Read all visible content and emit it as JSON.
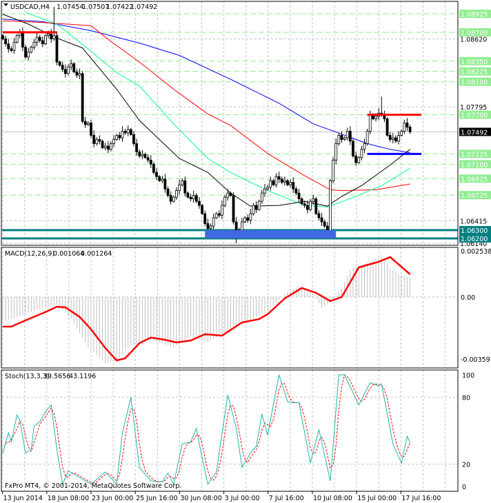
{
  "header": {
    "symbol": "USDCAD,H4",
    "open": "1.07454",
    "high": "1.07507",
    "low": "1.07422",
    "close": "1.07492"
  },
  "macd_header": {
    "name": "MACD(12,26,9)",
    "main": "0.001064",
    "signal": "0.001264"
  },
  "stoch_header": {
    "name": "Stoch(13,3,3)",
    "main": "39.5656",
    "signal": "43.1196"
  },
  "copyright": "FxPro MT4, © 2001-2014, MetaQuotes Software Corp.",
  "colors": {
    "level": "#90EE90",
    "support": "#008080",
    "candle": "#000000",
    "ma_blue": "#0000FF",
    "ma_red": "#FF0000",
    "ma_green": "#00FA9A",
    "ma_black": "#000000",
    "macd_signal": "#FF0000",
    "stoch_main": "#20B2AA",
    "stoch_signal": "#FF0000",
    "zone": "#4169E1"
  },
  "chart_data": [
    {
      "type": "candlestick",
      "title": "USDCAD,H4",
      "ylim": [
        1.0612,
        1.0895
      ],
      "price_labels": [
        "1.08620",
        "1.07795",
        "1.06415",
        "1.06140"
      ],
      "level_labels": [
        "1.08925",
        "1.08700",
        "1.08350",
        "1.08225",
        "1.08100",
        "1.07700",
        "1.07225",
        "1.07100",
        "1.06925",
        "1.06725"
      ],
      "support_labels": [
        "1.06300",
        "1.06200"
      ],
      "current_price": "1.07492",
      "x_labels": [
        "13 Jun 2014",
        "18 Jun 08:00",
        "23 Jun 00:00",
        "25 Jun 16:00",
        "30 Jun 08:00",
        "3 Jul 00:00",
        "7 Jul 16:00",
        "10 Jul 08:00",
        "15 Jul 00:00",
        "17 Jul 16:00"
      ],
      "closes": [
        1.0862,
        1.0856,
        1.085,
        1.0848,
        1.0858,
        1.0866,
        1.087,
        1.0852,
        1.084,
        1.0846,
        1.0852,
        1.0858,
        1.0864,
        1.086,
        1.0856,
        1.0866,
        1.0868,
        1.0862,
        1.0866,
        1.0834,
        1.083,
        1.0825,
        1.082,
        1.0828,
        1.0832,
        1.0822,
        1.0818,
        1.082,
        1.0762,
        1.0758,
        1.076,
        1.0745,
        1.0735,
        1.074,
        1.0738,
        1.073,
        1.0732,
        1.0728,
        1.0735,
        1.074,
        1.0745,
        1.0742,
        1.075,
        1.0748,
        1.0752,
        1.0746,
        1.0735,
        1.0725,
        1.072,
        1.0722,
        1.0718,
        1.0715,
        1.071,
        1.07,
        1.0695,
        1.069,
        1.0692,
        1.068,
        1.0672,
        1.0665,
        1.067,
        1.0678,
        1.0685,
        1.069,
        1.0675,
        1.067,
        1.0668,
        1.0672,
        1.0665,
        1.066,
        1.065,
        1.0638,
        1.0632,
        1.0635,
        1.0645,
        1.065,
        1.0648,
        1.066,
        1.067,
        1.0675,
        1.0672,
        1.064,
        1.0625,
        1.063,
        1.064,
        1.0645,
        1.0642,
        1.065,
        1.066,
        1.0655,
        1.0665,
        1.0675,
        1.068,
        1.0682,
        1.069,
        1.0685,
        1.0695,
        1.0692,
        1.0688,
        1.069,
        1.0685,
        1.0688,
        1.068,
        1.0675,
        1.0668,
        1.0662,
        1.066,
        1.0655,
        1.0665,
        1.0668,
        1.065,
        1.0645,
        1.064,
        1.0635,
        1.0628,
        1.069,
        1.0715,
        1.0735,
        1.0745,
        1.074,
        1.0742,
        1.075,
        1.0738,
        1.072,
        1.0712,
        1.0718,
        1.0728,
        1.0735,
        1.075,
        1.077,
        1.0765,
        1.0768,
        1.0772,
        1.077,
        1.0765,
        1.0745,
        1.074,
        1.0742,
        1.0738,
        1.0745,
        1.075,
        1.076,
        1.0755,
        1.07492
      ],
      "extreme_highs": [
        [
          18,
          1.0901
        ],
        [
          133,
          1.0792
        ]
      ],
      "extreme_lows": [
        [
          82,
          1.0614
        ]
      ],
      "moving_averages": [
        {
          "name": "blue",
          "points": [
            [
              0,
              1.0886
            ],
            [
              14,
              1.0883
            ],
            [
              31,
              1.0872
            ],
            [
              48,
              1.0857
            ],
            [
              62,
              1.0842
            ],
            [
              80,
              1.0813
            ],
            [
              97,
              1.0784
            ],
            [
              109,
              1.0759
            ],
            [
              121,
              1.0744
            ],
            [
              128,
              1.0735
            ],
            [
              136,
              1.0728
            ],
            [
              143,
              1.0724
            ]
          ]
        },
        {
          "name": "red",
          "points": [
            [
              0,
              1.0884
            ],
            [
              14,
              1.0882
            ],
            [
              31,
              1.0878
            ],
            [
              38,
              1.0859
            ],
            [
              48,
              1.0834
            ],
            [
              60,
              1.0801
            ],
            [
              72,
              1.0771
            ],
            [
              80,
              1.0757
            ],
            [
              93,
              1.0723
            ],
            [
              106,
              1.0696
            ],
            [
              115,
              1.0679
            ],
            [
              119,
              1.0678
            ],
            [
              131,
              1.0679
            ],
            [
              143,
              1.0686
            ]
          ]
        },
        {
          "name": "green",
          "points": [
            [
              8,
              1.0894
            ],
            [
              19,
              1.088
            ],
            [
              31,
              1.0847
            ],
            [
              40,
              1.0821
            ],
            [
              48,
              1.0805
            ],
            [
              60,
              1.0759
            ],
            [
              72,
              1.0717
            ],
            [
              80,
              1.07
            ],
            [
              93,
              1.0678
            ],
            [
              106,
              1.066
            ],
            [
              114,
              1.0658
            ],
            [
              121,
              1.0667
            ],
            [
              133,
              1.0684
            ],
            [
              143,
              1.0705
            ]
          ]
        },
        {
          "name": "black",
          "points": [
            [
              0,
              1.0892
            ],
            [
              9,
              1.088
            ],
            [
              19,
              1.0863
            ],
            [
              28,
              1.0851
            ],
            [
              40,
              1.0801
            ],
            [
              48,
              1.0763
            ],
            [
              62,
              1.0717
            ],
            [
              72,
              1.07
            ],
            [
              80,
              1.0675
            ],
            [
              87,
              1.0659
            ],
            [
              97,
              1.066
            ],
            [
              106,
              1.0665
            ],
            [
              114,
              1.0659
            ],
            [
              119,
              1.0671
            ],
            [
              126,
              1.0684
            ],
            [
              136,
              1.0709
            ],
            [
              143,
              1.0728
            ]
          ]
        }
      ],
      "drawn_lines": [
        {
          "name": "resistance-top",
          "price": 1.087,
          "from": 0,
          "to": 19,
          "color": "#FF0000"
        },
        {
          "name": "resistance-range",
          "price": 1.077,
          "from": 128,
          "to": 147,
          "color": "#FF0000"
        },
        {
          "name": "support-range",
          "price": 1.07225,
          "from": 128,
          "to": 147,
          "color": "#0000FF"
        }
      ],
      "zone": {
        "from": 71,
        "to": 117,
        "low": 1.062,
        "high": 1.063
      }
    },
    {
      "type": "bar+line",
      "title": "MACD(12,26,9)",
      "ylim": [
        -0.003597,
        0.002538
      ],
      "tick_labels": [
        "0.002538",
        "0.00",
        "-0.003597"
      ],
      "histogram": [
        [
          0,
          -0.0014
        ],
        [
          9,
          -0.0009
        ],
        [
          16,
          -0.0005
        ],
        [
          19,
          -0.0004
        ],
        [
          24,
          -0.0012
        ],
        [
          30,
          -0.0028
        ],
        [
          36,
          -0.0037
        ],
        [
          40,
          -0.0035
        ],
        [
          45,
          -0.0027
        ],
        [
          52,
          -0.0024
        ],
        [
          60,
          -0.0028
        ],
        [
          66,
          -0.0022
        ],
        [
          72,
          -0.0025
        ],
        [
          80,
          -0.0018
        ],
        [
          88,
          -0.0012
        ],
        [
          95,
          -0.0005
        ],
        [
          99,
          0.0002
        ],
        [
          104,
          0.0006
        ],
        [
          108,
          0.0004
        ],
        [
          112,
          -0.0006
        ],
        [
          115,
          -0.0003
        ],
        [
          119,
          0.0005
        ],
        [
          122,
          0.0015
        ],
        [
          127,
          0.0018
        ],
        [
          133,
          0.0023
        ],
        [
          136,
          0.0016
        ],
        [
          140,
          0.0012
        ],
        [
          143,
          0.001064
        ]
      ],
      "signal": [
        [
          0,
          -0.00165
        ],
        [
          3,
          -0.00165
        ],
        [
          9,
          -0.00123
        ],
        [
          15,
          -0.00084
        ],
        [
          19,
          -0.00054
        ],
        [
          22,
          -0.00058
        ],
        [
          27,
          -0.00111
        ],
        [
          31,
          -0.0018
        ],
        [
          36,
          -0.00284
        ],
        [
          40,
          -0.00353
        ],
        [
          43,
          -0.00341
        ],
        [
          48,
          -0.00257
        ],
        [
          52,
          -0.00226
        ],
        [
          57,
          -0.00238
        ],
        [
          61,
          -0.00253
        ],
        [
          66,
          -0.00242
        ],
        [
          71,
          -0.00207
        ],
        [
          77,
          -0.00215
        ],
        [
          84,
          -0.00142
        ],
        [
          90,
          -0.00123
        ],
        [
          93,
          -0.00096
        ],
        [
          99,
          -8e-05
        ],
        [
          105,
          0.0005
        ],
        [
          110,
          0.00023
        ],
        [
          115,
          -0.00023
        ],
        [
          119,
          0
        ],
        [
          125,
          0.00165
        ],
        [
          132,
          0.00196
        ],
        [
          136,
          0.00222
        ],
        [
          143,
          0.001264
        ]
      ]
    },
    {
      "type": "line",
      "title": "Stoch(13,3,3)",
      "ylim": [
        0,
        100
      ],
      "tick_labels": [
        "100",
        "80",
        "20",
        "0"
      ],
      "main": [
        [
          0,
          30
        ],
        [
          2,
          48
        ],
        [
          3,
          40
        ],
        [
          5,
          64
        ],
        [
          6,
          59
        ],
        [
          8,
          30
        ],
        [
          10,
          33
        ],
        [
          11,
          54
        ],
        [
          13,
          58
        ],
        [
          15,
          67
        ],
        [
          17,
          73
        ],
        [
          19,
          33
        ],
        [
          21,
          2
        ],
        [
          23,
          14
        ],
        [
          27,
          8
        ],
        [
          31,
          2
        ],
        [
          36,
          13
        ],
        [
          40,
          2
        ],
        [
          42,
          48
        ],
        [
          45,
          80
        ],
        [
          48,
          17
        ],
        [
          52,
          5
        ],
        [
          56,
          4
        ],
        [
          58,
          12
        ],
        [
          60,
          2
        ],
        [
          63,
          38
        ],
        [
          66,
          40
        ],
        [
          68,
          52
        ],
        [
          69,
          38
        ],
        [
          72,
          2
        ],
        [
          75,
          13
        ],
        [
          79,
          82
        ],
        [
          82,
          52
        ],
        [
          84,
          17
        ],
        [
          87,
          30
        ],
        [
          89,
          36
        ],
        [
          91,
          65
        ],
        [
          93,
          46
        ],
        [
          97,
          100
        ],
        [
          100,
          76
        ],
        [
          102,
          75
        ],
        [
          104,
          75
        ],
        [
          108,
          21
        ],
        [
          111,
          51
        ],
        [
          115,
          5
        ],
        [
          118,
          100
        ],
        [
          120,
          100
        ],
        [
          125,
          73
        ],
        [
          129,
          93
        ],
        [
          132,
          90
        ],
        [
          133,
          92
        ],
        [
          137,
          38
        ],
        [
          140,
          21
        ],
        [
          142,
          45
        ],
        [
          143,
          39.5656
        ]
      ]
    }
  ]
}
